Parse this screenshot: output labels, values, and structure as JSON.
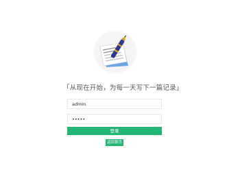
{
  "logo": {
    "icon": "notebook-pen-icon"
  },
  "slogan": "「从现在开始，为每一天写下一篇记录」",
  "form": {
    "username_value": "admin",
    "password_value": "•••••",
    "login_label": "登录",
    "home_label": "返回首页"
  },
  "colors": {
    "accent": "#22b573",
    "background": "#ffffff",
    "text": "#555555"
  }
}
